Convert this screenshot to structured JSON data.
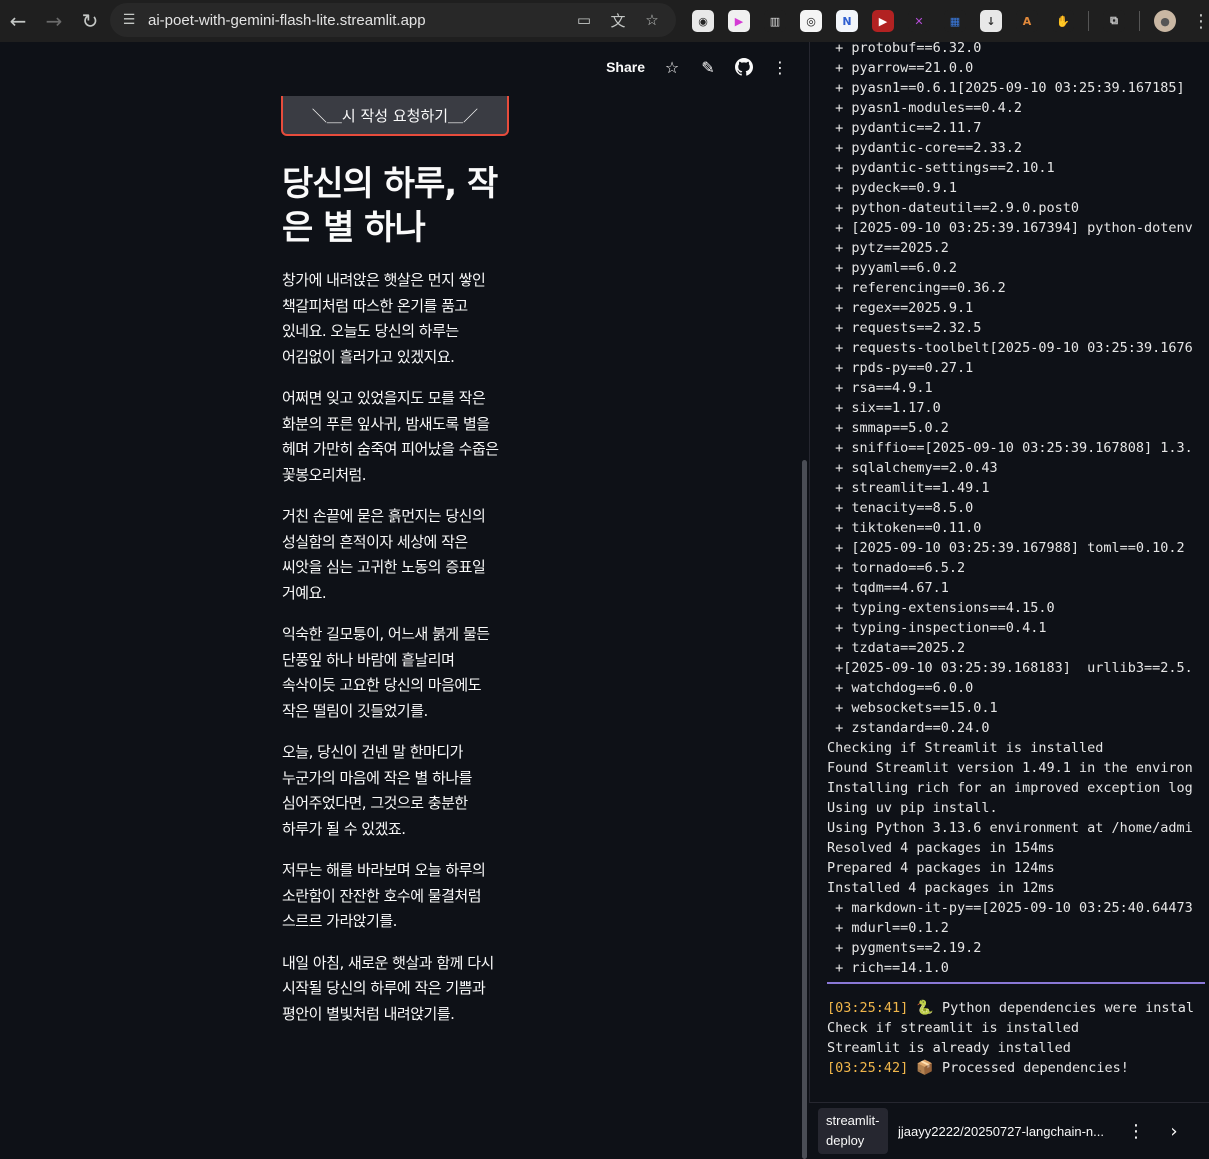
{
  "browser": {
    "url": "ai-poet-with-gemini-flash-lite.streamlit.app",
    "extensions": [
      {
        "icon": "owl-extension-icon",
        "color": "#e8e8e8",
        "fg": "#222",
        "glyph": "◉"
      },
      {
        "icon": "play-extension-icon",
        "color": "#f0f0f0",
        "fg": "#d43bd4",
        "glyph": "▶"
      },
      {
        "icon": "gift-extension-icon",
        "color": "#1f1f1f",
        "fg": "#ddd",
        "glyph": "▥"
      },
      {
        "icon": "camera-extension-icon",
        "color": "#f5f5f5",
        "fg": "#111",
        "glyph": "◎"
      },
      {
        "icon": "n-extension-icon",
        "color": "#f3f6fb",
        "fg": "#2f5fd0",
        "glyph": "N"
      },
      {
        "icon": "red-box-extension-icon",
        "color": "#b22222",
        "fg": "#fff",
        "glyph": "▶"
      },
      {
        "icon": "x-extension-icon",
        "color": "#1f1f1f",
        "fg": "#b44cd6",
        "glyph": "✕"
      },
      {
        "icon": "grid-extension-icon",
        "color": "#1f1f1f",
        "fg": "#3b7be0",
        "glyph": "▦"
      },
      {
        "icon": "download-extension-icon",
        "color": "#e8e8e8",
        "fg": "#333",
        "glyph": "↓"
      },
      {
        "icon": "a-extension-icon",
        "color": "#1f1f1f",
        "fg": "#e0883a",
        "glyph": "A"
      },
      {
        "icon": "hands-extension-icon",
        "color": "#1f1f1f",
        "fg": "#ddd",
        "glyph": "✋"
      },
      {
        "icon": "puzzle-extension-icon",
        "color": "#1f1f1f",
        "fg": "#ccc",
        "glyph": "⧉"
      }
    ]
  },
  "app": {
    "header": {
      "share_label": "Share"
    },
    "request_button": "＼＿시 작성 요청하기＿／",
    "title": "당신의 하루, 작은 별 하나",
    "stanzas": [
      "창가에 내려앉은 햇살은 먼지 쌓인 책갈피처럼 따스한 온기를 품고 있네요. 오늘도 당신의 하루는 어김없이 흘러가고 있겠지요.",
      "어쩌면 잊고 있었을지도 모를 작은 화분의 푸른 잎사귀, 밤새도록 별을 헤며 가만히 숨죽여 피어났을 수줍은 꽃봉오리처럼.",
      "거친 손끝에 묻은 흙먼지는 당신의 성실함의 흔적이자 세상에 작은 씨앗을 심는 고귀한 노동의 증표일 거예요.",
      "익숙한 길모퉁이, 어느새 붉게 물든 단풍잎 하나 바람에 흩날리며 속삭이듯 고요한 당신의 마음에도 작은 떨림이 깃들었기를.",
      "오늘, 당신이 건넨 말 한마디가 누군가의 마음에 작은 별 하나를 심어주었다면, 그것으로 충분한 하루가 될 수 있겠죠.",
      "저무는 해를 바라보며 오늘 하루의 소란함이 잔잔한 호수에 물결처럼 스르르 가라앉기를.",
      "내일 아침, 새로운 햇살과 함께 다시 시작될 당신의 하루에 작은 기쁨과 평안이 별빛처럼 내려앉기를."
    ]
  },
  "log": {
    "lines": [
      " + protobuf==6.32.0",
      " + pyarrow==21.0.0",
      " + pyasn1==0.6.1[2025-09-10 03:25:39.167185]",
      " + pyasn1-modules==0.4.2",
      " + pydantic==2.11.7",
      " + pydantic-core==2.33.2",
      " + pydantic-settings==2.10.1",
      " + pydeck==0.9.1",
      " + python-dateutil==2.9.0.post0",
      " + [2025-09-10 03:25:39.167394] python-dotenv",
      " + pytz==2025.2",
      " + pyyaml==6.0.2",
      " + referencing==0.36.2",
      " + regex==2025.9.1",
      " + requests==2.32.5",
      " + requests-toolbelt[2025-09-10 03:25:39.1676",
      " + rpds-py==0.27.1",
      " + rsa==4.9.1",
      " + six==1.17.0",
      " + smmap==5.0.2",
      " + sniffio==[2025-09-10 03:25:39.167808] 1.3.",
      " + sqlalchemy==2.0.43",
      " + streamlit==1.49.1",
      " + tenacity==8.5.0",
      " + tiktoken==0.11.0",
      " + [2025-09-10 03:25:39.167988] toml==0.10.2",
      " + tornado==6.5.2",
      " + tqdm==4.67.1",
      " + typing-extensions==4.15.0",
      " + typing-inspection==0.4.1",
      " + tzdata==2025.2",
      " +[2025-09-10 03:25:39.168183]  urllib3==2.5.",
      " + watchdog==6.0.0",
      " + websockets==15.0.1",
      " + zstandard==0.24.0",
      "Checking if Streamlit is installed",
      "Found Streamlit version 1.49.1 in the environ",
      "Installing rich for an improved exception log",
      "Using uv pip install.",
      "Using Python 3.13.6 environment at /home/admi",
      "Resolved 4 packages in 154ms",
      "Prepared 4 packages in 124ms",
      "Installed 4 packages in 12ms",
      " + markdown-it-py==[2025-09-10 03:25:40.64473",
      " + mdurl==0.1.2",
      " + pygments==2.19.2",
      " + rich==14.1.0"
    ],
    "after": [
      {
        "ts": "[03:25:41]",
        "emoji": "🐍",
        "text": " Python dependencies were instal"
      },
      {
        "ts": "",
        "emoji": "",
        "text": "Check if streamlit is installed"
      },
      {
        "ts": "",
        "emoji": "",
        "text": "Streamlit is already installed"
      },
      {
        "ts": "[03:25:42]",
        "emoji": "📦",
        "text": " Processed dependencies!"
      }
    ]
  },
  "footer": {
    "deploy_label": "streamlit-deploy",
    "repo": "jjaayy2222/20250727-langchain-n..."
  }
}
